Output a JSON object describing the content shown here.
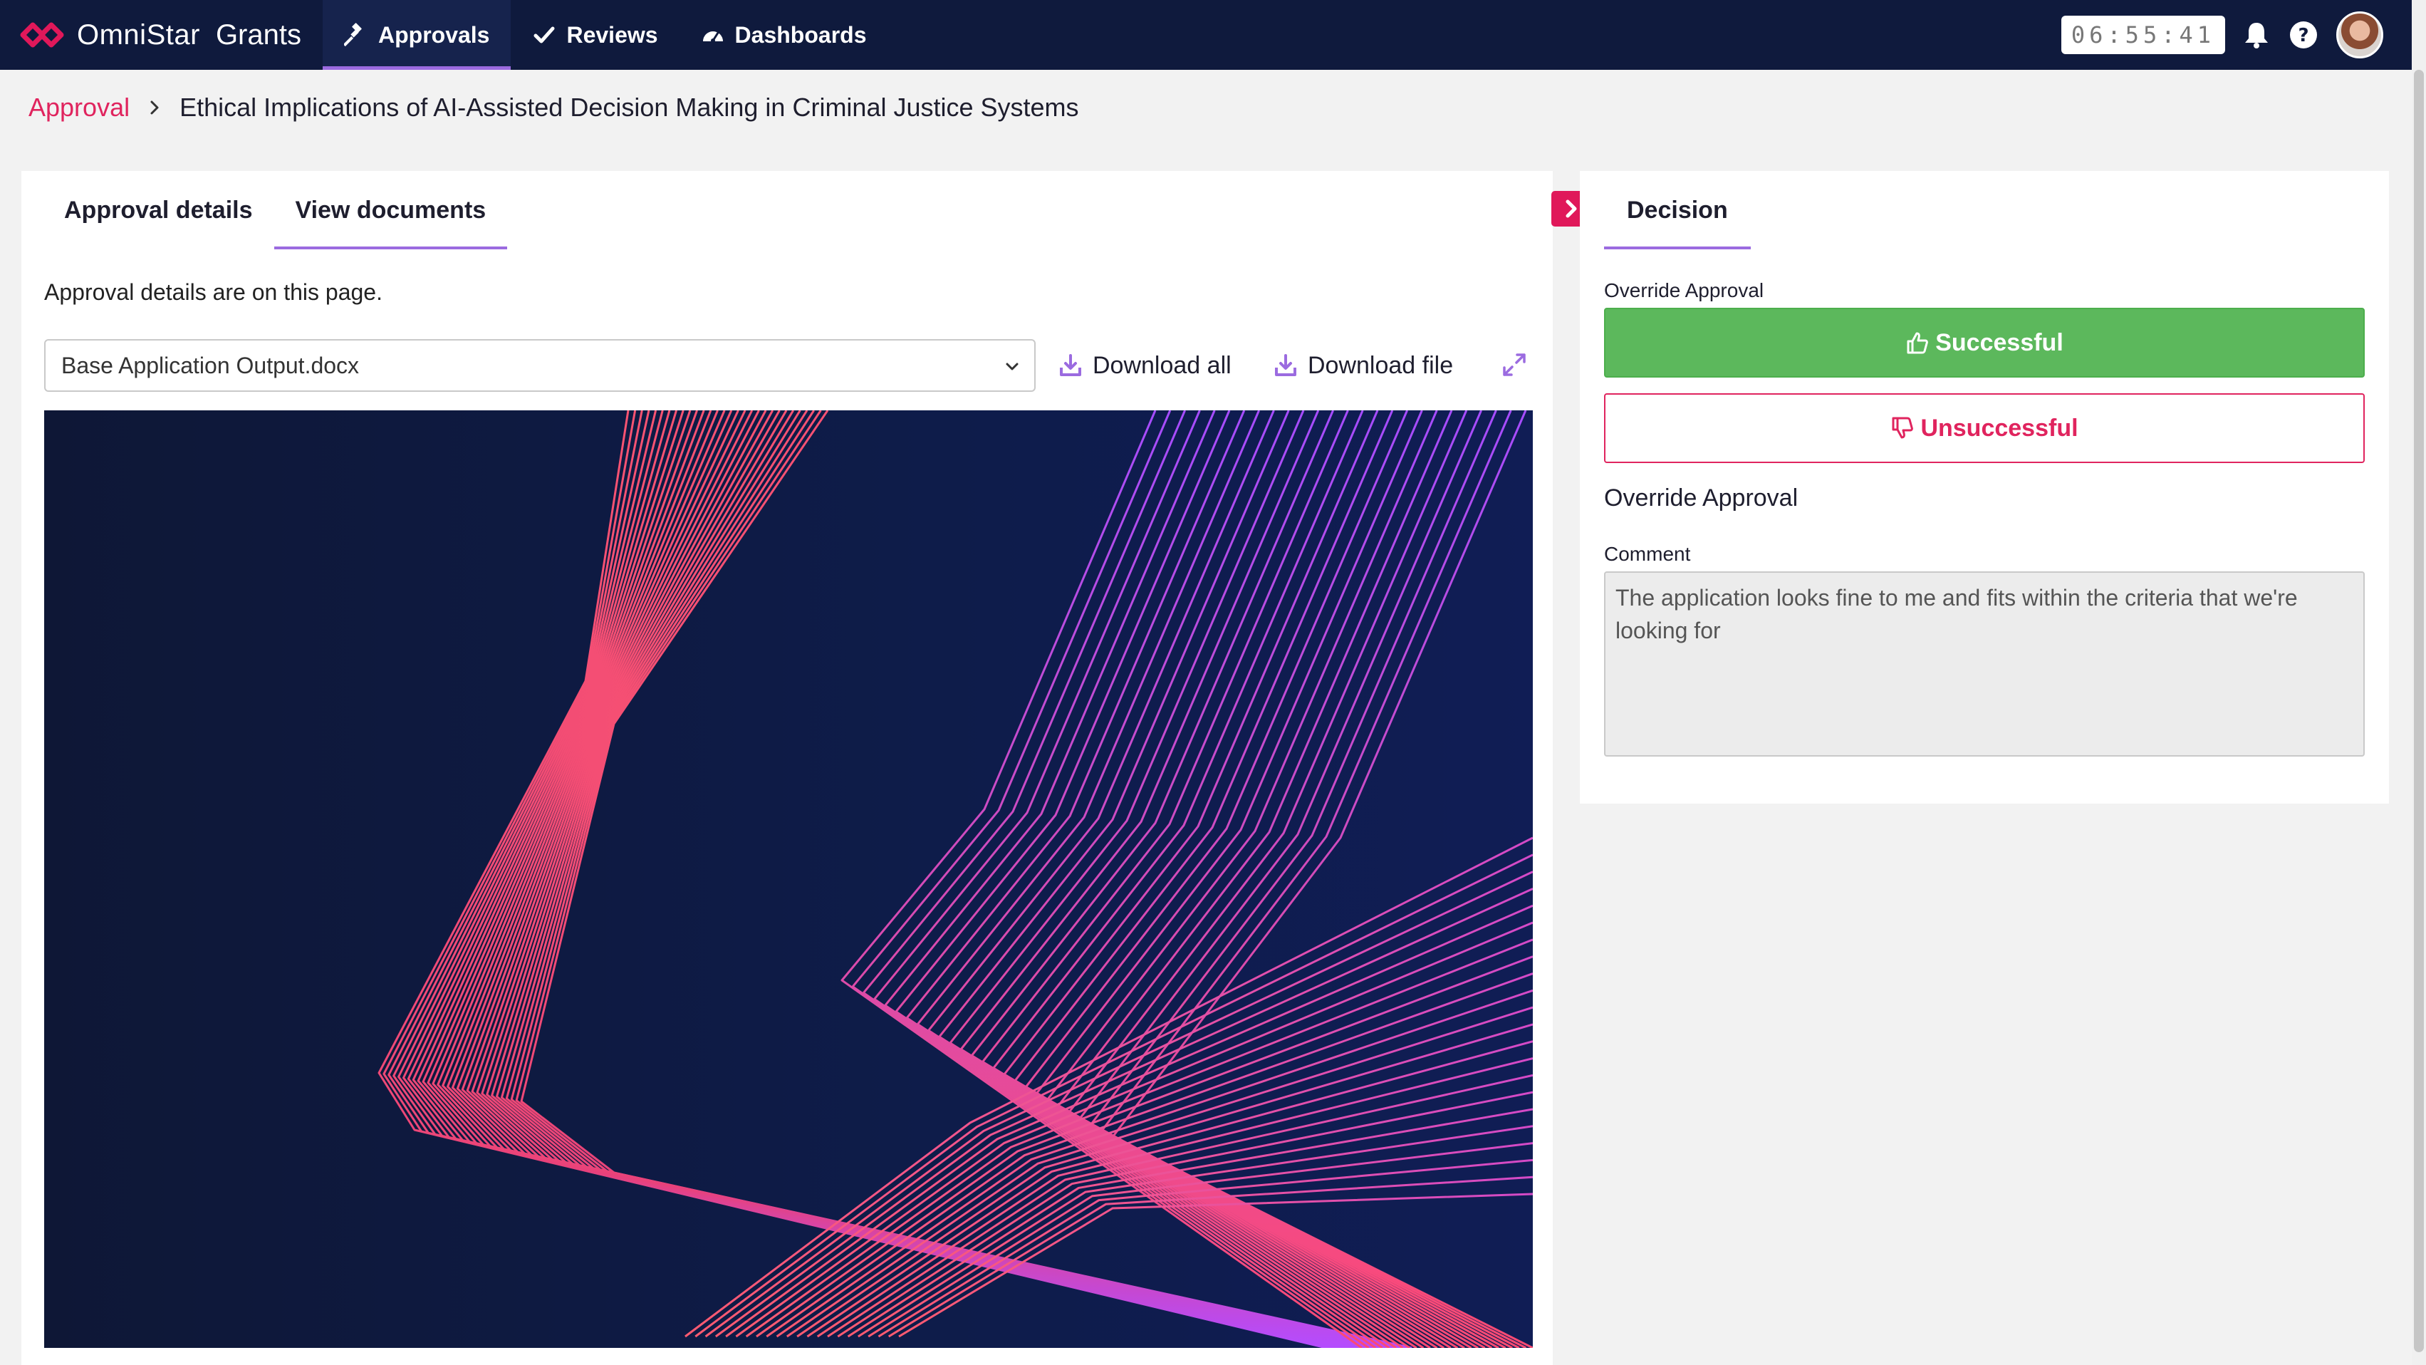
{
  "app": {
    "brand": "OmniStar",
    "product": "Grants",
    "brand_color": "#e0185a"
  },
  "nav": {
    "items": [
      {
        "label": "Approvals",
        "icon": "gavel-icon",
        "active": true
      },
      {
        "label": "Reviews",
        "icon": "check-icon",
        "active": false
      },
      {
        "label": "Dashboards",
        "icon": "dashboard-icon",
        "active": false
      }
    ],
    "timer": "06:55:41"
  },
  "breadcrumb": {
    "parent": "Approval",
    "current": "Ethical Implications of AI-Assisted Decision Making in Criminal Justice Systems"
  },
  "left": {
    "tabs": [
      {
        "label": "Approval details",
        "active": false
      },
      {
        "label": "View documents",
        "active": true
      }
    ],
    "info": "Approval details are on this page.",
    "document_select": "Base Application Output.docx",
    "download_all": "Download all",
    "download_file": "Download file"
  },
  "right": {
    "tab": "Decision",
    "override_label": "Override Approval",
    "success_label": "Successful",
    "fail_label": "Unsuccessful",
    "override_heading": "Override Approval",
    "comment_label": "Comment",
    "comment_value": "The application looks fine to me and fits within the criteria that we're looking for",
    "success_color": "#5cb85c",
    "fail_color": "#e0245e"
  }
}
